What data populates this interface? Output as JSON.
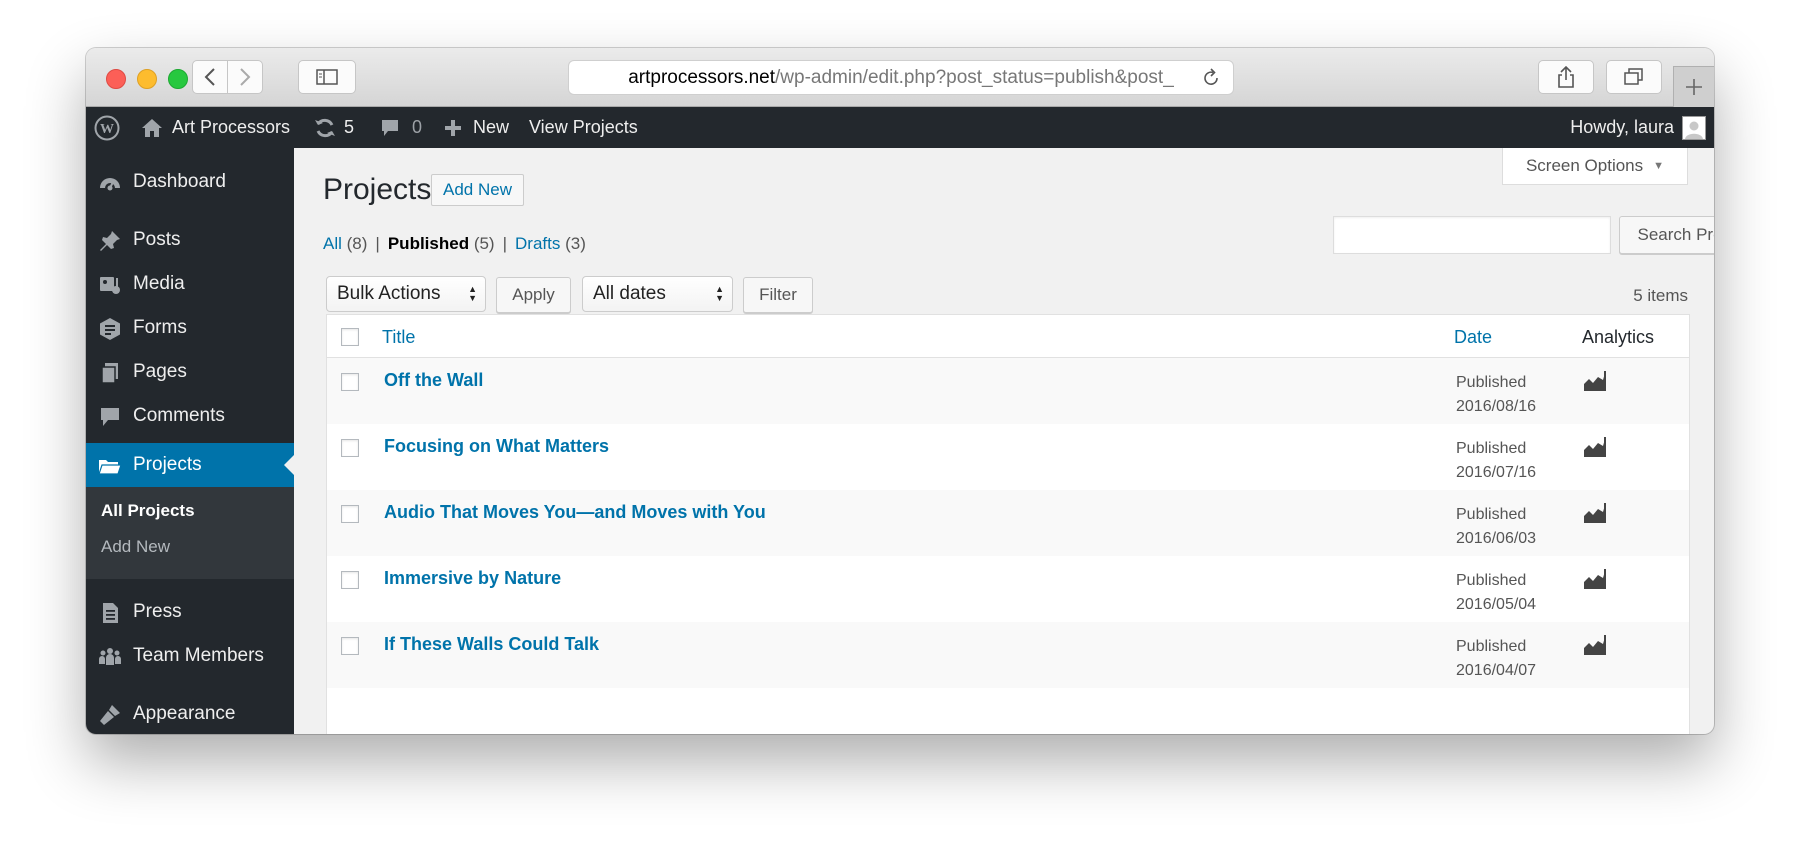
{
  "browser": {
    "url_host": "artprocessors.net",
    "url_path": "/wp-admin/edit.php?post_status=publish&post_"
  },
  "admin_bar": {
    "site_name": "Art Processors",
    "updates_count": "5",
    "comments_count": "0",
    "new_label": "New",
    "view_label": "View Projects",
    "howdy": "Howdy, laura"
  },
  "sidebar": {
    "items": [
      {
        "label": "Dashboard",
        "icon": "dashboard-icon"
      },
      {
        "label": "Posts",
        "icon": "pin-icon"
      },
      {
        "label": "Media",
        "icon": "media-icon"
      },
      {
        "label": "Forms",
        "icon": "forms-icon"
      },
      {
        "label": "Pages",
        "icon": "pages-icon"
      },
      {
        "label": "Comments",
        "icon": "comment-icon"
      },
      {
        "label": "Projects",
        "icon": "folder-icon"
      },
      {
        "label": "Press",
        "icon": "document-icon"
      },
      {
        "label": "Team Members",
        "icon": "team-icon"
      },
      {
        "label": "Appearance",
        "icon": "brush-icon"
      }
    ],
    "submenu": [
      {
        "label": "All Projects"
      },
      {
        "label": "Add New"
      }
    ]
  },
  "page": {
    "screen_options": "Screen Options",
    "title": "Projects",
    "add_new": "Add New",
    "filters": {
      "all_label": "All",
      "all_count": "(8)",
      "published_label": "Published",
      "published_count": "(5)",
      "drafts_label": "Drafts",
      "drafts_count": "(3)",
      "separator": "|"
    },
    "search_button": "Search Projects",
    "bulk_actions": "Bulk Actions",
    "apply": "Apply",
    "all_dates": "All dates",
    "filter": "Filter",
    "items_count": "5 items"
  },
  "table": {
    "columns": {
      "title": "Title",
      "date": "Date",
      "analytics": "Analytics"
    },
    "rows": [
      {
        "title": "Off the Wall",
        "status": "Published",
        "date": "2016/08/16"
      },
      {
        "title": "Focusing on What Matters",
        "status": "Published",
        "date": "2016/07/16"
      },
      {
        "title": "Audio That Moves You—and Moves with You",
        "status": "Published",
        "date": "2016/06/03"
      },
      {
        "title": "Immersive by Nature",
        "status": "Published",
        "date": "2016/05/04"
      },
      {
        "title": "If These Walls Could Talk",
        "status": "Published",
        "date": "2016/04/07"
      }
    ]
  },
  "colors": {
    "admin_dark": "#23282d",
    "accent": "#0073aa",
    "submenu_bg": "#32373c",
    "content_bg": "#f1f1f1"
  }
}
